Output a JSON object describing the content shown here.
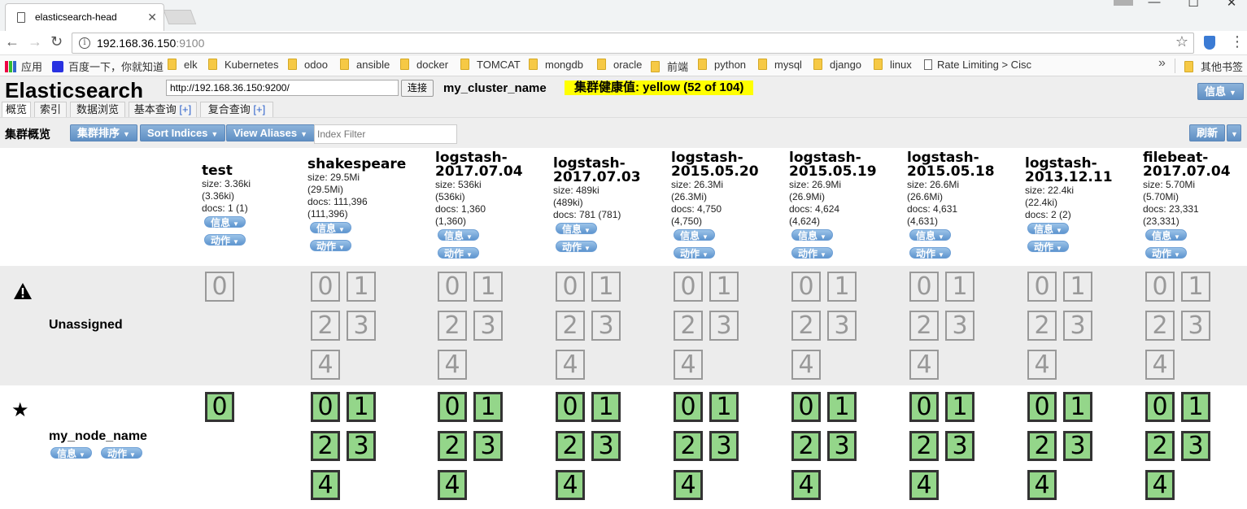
{
  "browser": {
    "tab_title": "elasticsearch-head",
    "url_host": "192.168.36.150",
    "url_port": ":9100",
    "bookmarks": [
      "应用",
      "百度一下，你就知道",
      "elk",
      "Kubernetes",
      "odoo",
      "ansible",
      "docker",
      "TOMCAT",
      "mongdb",
      "oracle",
      "前端",
      "python",
      "mysql",
      "django",
      "linux",
      "Rate Limiting > Cisc",
      "其他书签"
    ],
    "bookmarks_more": "»"
  },
  "header": {
    "title": "Elasticsearch",
    "connect_url": "http://192.168.36.150:9200/",
    "connect_label": "连接",
    "cluster_name": "my_cluster_name",
    "health": "集群健康值: yellow (52 of 104)",
    "health_color": "#ffff00",
    "info_label": "信息"
  },
  "tabs": [
    {
      "label": "概览",
      "plus": ""
    },
    {
      "label": "索引",
      "plus": ""
    },
    {
      "label": "数据浏览",
      "plus": ""
    },
    {
      "label": "基本查询",
      "plus": "[+]"
    },
    {
      "label": "复合查询",
      "plus": "[+]"
    }
  ],
  "toolbar": {
    "section_title": "集群概览",
    "sort_cluster": "集群排序",
    "sort_indices": "Sort Indices",
    "view_aliases": "View Aliases",
    "index_filter_placeholder": "Index Filter",
    "refresh": "刷新"
  },
  "pill_labels": {
    "info": "信息",
    "action": "动作"
  },
  "indices": [
    {
      "name_lines": [
        "test"
      ],
      "size": "size: 3.36ki",
      "size2": "(3.36ki)",
      "docs": "docs: 1 (1)",
      "docs2": "",
      "shards": 1
    },
    {
      "name_lines": [
        "shakespeare"
      ],
      "size": "size: 29.5Mi",
      "size2": "(29.5Mi)",
      "docs": "docs: 111,396",
      "docs2": "(111,396)",
      "shards": 5
    },
    {
      "name_lines": [
        "logstash-",
        "2017.07.04"
      ],
      "size": "size: 536ki",
      "size2": "(536ki)",
      "docs": "docs: 1,360",
      "docs2": "(1,360)",
      "shards": 5
    },
    {
      "name_lines": [
        "logstash-",
        "2017.07.03"
      ],
      "size": "size: 489ki",
      "size2": "(489ki)",
      "docs": "docs: 781 (781)",
      "docs2": "",
      "shards": 5
    },
    {
      "name_lines": [
        "logstash-",
        "2015.05.20"
      ],
      "size": "size: 26.3Mi",
      "size2": "(26.3Mi)",
      "docs": "docs: 4,750",
      "docs2": "(4,750)",
      "shards": 5
    },
    {
      "name_lines": [
        "logstash-",
        "2015.05.19"
      ],
      "size": "size: 26.9Mi",
      "size2": "(26.9Mi)",
      "docs": "docs: 4,624",
      "docs2": "(4,624)",
      "shards": 5
    },
    {
      "name_lines": [
        "logstash-",
        "2015.05.18"
      ],
      "size": "size: 26.6Mi",
      "size2": "(26.6Mi)",
      "docs": "docs: 4,631",
      "docs2": "(4,631)",
      "shards": 5
    },
    {
      "name_lines": [
        "logstash-",
        "2013.12.11"
      ],
      "size": "size: 22.4ki",
      "size2": "(22.4ki)",
      "docs": "docs: 2 (2)",
      "docs2": "",
      "shards": 5
    },
    {
      "name_lines": [
        "filebeat-",
        "2017.07.04"
      ],
      "size": "size: 5.70Mi",
      "size2": "(5.70Mi)",
      "docs": "docs: 23,331",
      "docs2": "(23,331)",
      "shards": 5
    }
  ],
  "rows": {
    "unassigned_label": "Unassigned",
    "node_label": "my_node_name"
  },
  "colors": {
    "primary_shard": "#94d68a",
    "button_blue": "#5f8fc4"
  }
}
